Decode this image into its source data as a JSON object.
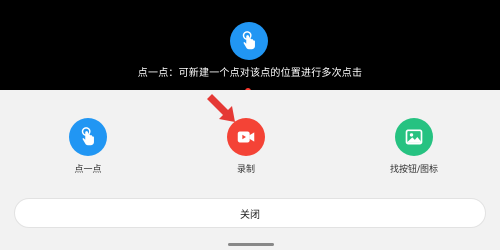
{
  "overlay": {
    "instruction_text": "点一点：可新建一个点对该点的位置进行多次点击",
    "icon": "hand-tap-icon"
  },
  "options": [
    {
      "label": "点一点",
      "icon": "hand-tap-icon",
      "color": "#2196f3"
    },
    {
      "label": "录制",
      "icon": "video-record-icon",
      "color": "#f44336"
    },
    {
      "label": "找按钮/图标",
      "icon": "image-search-icon",
      "color": "#26c281"
    }
  ],
  "close_label": "关闭",
  "colors": {
    "top_bg": "#000000",
    "sheet_bg": "#f2f2f2",
    "arrow": "#e53935",
    "red_dot": "#ff3b30"
  }
}
